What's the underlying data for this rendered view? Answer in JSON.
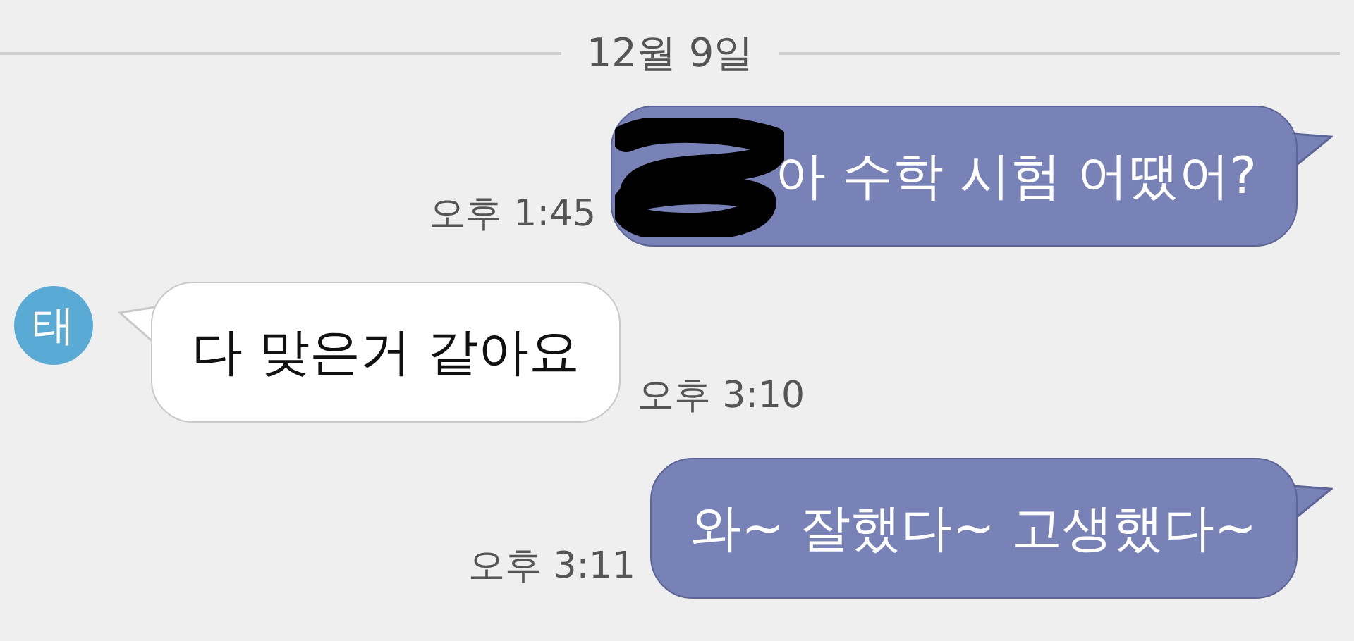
{
  "date_divider": "12월 9일",
  "messages": [
    {
      "kind": "outgoing",
      "text": "아 수학 시험 어땠어?",
      "time": "오후 1:45",
      "redacted": true
    },
    {
      "kind": "incoming",
      "avatar": "태",
      "text": "다 맞은거 같아요",
      "time": "오후 3:10"
    },
    {
      "kind": "outgoing",
      "text": "와~ 잘했다~ 고생했다~",
      "time": "오후 3:11",
      "redacted": false
    }
  ]
}
